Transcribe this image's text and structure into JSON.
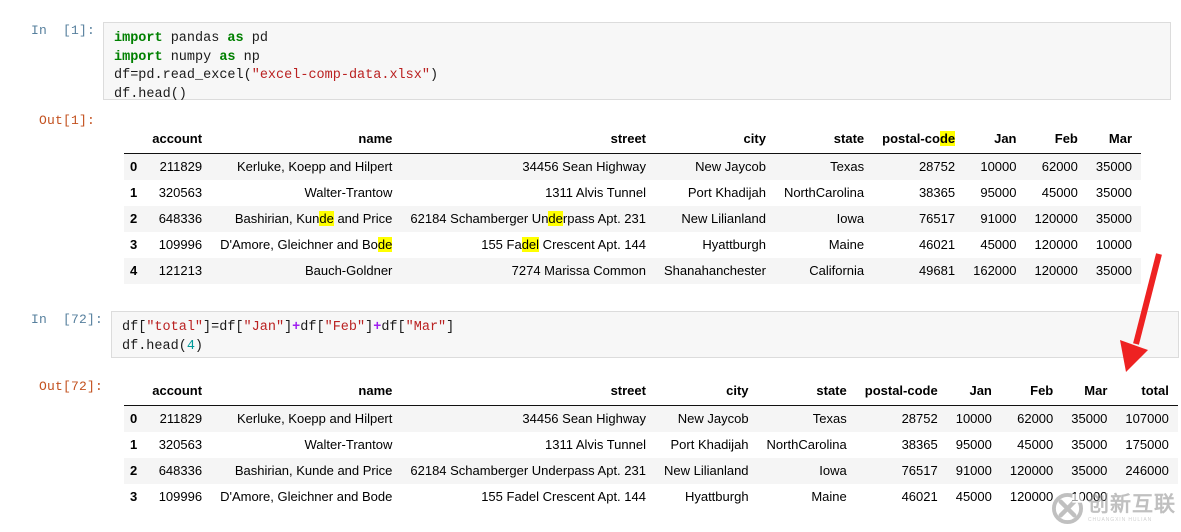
{
  "notebook": {
    "cells": [
      {
        "prompt": "In  [1]:",
        "kind": "input",
        "code_plain": "import pandas as pd\nimport numpy as np\ndf=pd.read_excel(\"excel-comp-data.xlsx\")\ndf.head()"
      },
      {
        "prompt": "Out[1]:",
        "kind": "output"
      },
      {
        "prompt": "In  [72]:",
        "kind": "input",
        "code_plain": "df[\"total\"]=df[\"Jan\"]+df[\"Feb\"]+df[\"Mar\"]\ndf.head(4)"
      },
      {
        "prompt": "Out[72]:",
        "kind": "output"
      }
    ]
  },
  "code1": {
    "l1_kw1": "import",
    "l1_mod": " pandas ",
    "l1_kw2": "as",
    "l1_alias": " pd",
    "l2_kw1": "import",
    "l2_mod": " numpy ",
    "l2_kw2": "as",
    "l2_alias": " np",
    "l3_pre": "df=pd.read_excel(",
    "l3_str": "\"excel-comp-data.xlsx\"",
    "l3_post": ")",
    "l4": "df.head()"
  },
  "code2": {
    "p1": "df[",
    "s1": "\"total\"",
    "p2": "]=df[",
    "s2": "\"Jan\"",
    "p3": "]",
    "op1": "+",
    "p4": "df[",
    "s3": "\"Feb\"",
    "p5": "]",
    "op2": "+",
    "p6": "df[",
    "s4": "\"Mar\"",
    "p7": "]",
    "l2_pre": "df.head(",
    "l2_num": "4",
    "l2_post": ")"
  },
  "table1": {
    "columns": [
      "",
      "account",
      "name",
      "street",
      "city",
      "state",
      "postal-code",
      "Jan",
      "Feb",
      "Mar"
    ],
    "postal_code_head": {
      "plain": "postal-co",
      "highlight": "de"
    },
    "rows": [
      {
        "idx": "0",
        "account": "211829",
        "name": "Kerluke, Koepp and Hilpert",
        "street": "34456 Sean Highway",
        "city": "New Jaycob",
        "state": "Texas",
        "postal": "28752",
        "jan": "10000",
        "feb": "62000",
        "mar": "35000"
      },
      {
        "idx": "1",
        "account": "320563",
        "name": "Walter-Trantow",
        "street": "1311 Alvis Tunnel",
        "city": "Port Khadijah",
        "state": "NorthCarolina",
        "postal": "38365",
        "jan": "95000",
        "feb": "45000",
        "mar": "35000"
      },
      {
        "idx": "2",
        "account": "648336",
        "name": "Bashirian, Kunde and Price",
        "name_parts": [
          {
            "t": "Bashirian, Kun",
            "h": false
          },
          {
            "t": "de",
            "h": true
          },
          {
            "t": " and Price",
            "h": false
          }
        ],
        "street": "62184 Schamberger Underpass Apt. 231",
        "street_parts": [
          {
            "t": "62184 Schamberger Un",
            "h": false
          },
          {
            "t": "de",
            "h": true
          },
          {
            "t": "rpass Apt. 231",
            "h": false
          }
        ],
        "city": "New Lilianland",
        "state": "Iowa",
        "postal": "76517",
        "jan": "91000",
        "feb": "120000",
        "mar": "35000"
      },
      {
        "idx": "3",
        "account": "109996",
        "name": "D'Amore, Gleichner and Bode",
        "name_parts": [
          {
            "t": "D'Amore, Gleichner and Bo",
            "h": false
          },
          {
            "t": "de",
            "h": true
          }
        ],
        "street": "155 Fadel Crescent Apt. 144",
        "street_parts": [
          {
            "t": "155 Fa",
            "h": false
          },
          {
            "t": "del",
            "h": true
          },
          {
            "t": " Crescent Apt. 144",
            "h": false
          }
        ],
        "city": "Hyattburgh",
        "state": "Maine",
        "postal": "46021",
        "jan": "45000",
        "feb": "120000",
        "mar": "10000"
      },
      {
        "idx": "4",
        "account": "121213",
        "name": "Bauch-Goldner",
        "street": "7274 Marissa Common",
        "city": "Shanahanchester",
        "state": "California",
        "postal": "49681",
        "jan": "162000",
        "feb": "120000",
        "mar": "35000"
      }
    ]
  },
  "table2": {
    "columns": [
      "",
      "account",
      "name",
      "street",
      "city",
      "state",
      "postal-code",
      "Jan",
      "Feb",
      "Mar",
      "total"
    ],
    "rows": [
      {
        "idx": "0",
        "account": "211829",
        "name": "Kerluke, Koepp and Hilpert",
        "street": "34456 Sean Highway",
        "city": "New Jaycob",
        "state": "Texas",
        "postal": "28752",
        "jan": "10000",
        "feb": "62000",
        "mar": "35000",
        "total": "107000"
      },
      {
        "idx": "1",
        "account": "320563",
        "name": "Walter-Trantow",
        "street": "1311 Alvis Tunnel",
        "city": "Port Khadijah",
        "state": "NorthCarolina",
        "postal": "38365",
        "jan": "95000",
        "feb": "45000",
        "mar": "35000",
        "total": "175000"
      },
      {
        "idx": "2",
        "account": "648336",
        "name": "Bashirian, Kunde and Price",
        "street": "62184 Schamberger Underpass Apt. 231",
        "city": "New Lilianland",
        "state": "Iowa",
        "postal": "76517",
        "jan": "91000",
        "feb": "120000",
        "mar": "35000",
        "total": "246000"
      },
      {
        "idx": "3",
        "account": "109996",
        "name": "D'Amore, Gleichner and Bode",
        "street": "155 Fadel Crescent Apt. 144",
        "city": "Hyattburgh",
        "state": "Maine",
        "postal": "46021",
        "jan": "45000",
        "feb": "120000",
        "mar": "10000",
        "total": ""
      }
    ]
  },
  "annotation": {
    "arrow_color": "#ee2222",
    "arrow_name": "red-down-left-arrow"
  },
  "watermark": {
    "cn": "创新互联",
    "pinyin": "CHUANGXIN HULIAN",
    "logo_glyph": "X"
  },
  "colors": {
    "highlight": "#ffff00",
    "in_prompt": "#57809e",
    "out_prompt": "#c3511f",
    "code_bg": "#f7f7f7",
    "code_border": "#dcdcdc",
    "row_stripe": "#f5f5f5",
    "keyword": "#008000",
    "string": "#ba2121",
    "operator": "#a020f0",
    "number": "#009999"
  }
}
